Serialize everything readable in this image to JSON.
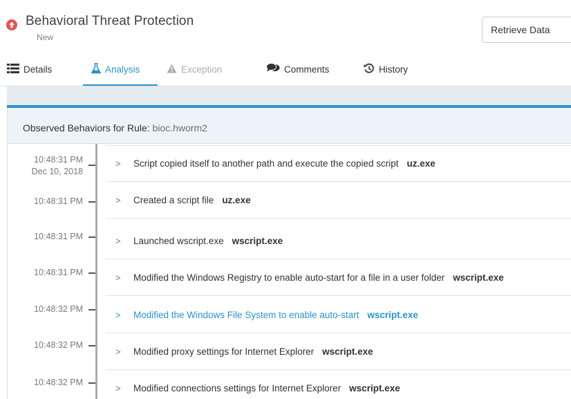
{
  "header": {
    "title": "Behavioral Threat Protection",
    "status": "New",
    "retrieve_button": "Retrieve Data",
    "alert_icon": "circle-arrow-up-icon",
    "alert_color": "#e45457"
  },
  "tabs": [
    {
      "label": "Details",
      "icon": "list-icon",
      "state": "normal"
    },
    {
      "label": "Analysis",
      "icon": "flask-icon",
      "state": "active"
    },
    {
      "label": "Exception",
      "icon": "warning-icon",
      "state": "disabled"
    },
    {
      "label": "Comments",
      "icon": "comments-icon",
      "state": "normal"
    },
    {
      "label": "History",
      "icon": "history-icon",
      "state": "normal"
    }
  ],
  "panel": {
    "heading_prefix": "Observed Behaviors for Rule:",
    "rule_name": "bioc.hworm2"
  },
  "colors": {
    "accent": "#2a93c8",
    "header_bg": "#eef3f7",
    "band_bg": "#e6ebef"
  },
  "behaviors": [
    {
      "time": "10:48:31 PM",
      "date": "Dec 10, 2018",
      "description": "Script copied itself to another path and execute the copied script",
      "process": "uz.exe"
    },
    {
      "time": "10:48:31 PM",
      "date": "",
      "description": "Created a script file",
      "process": "uz.exe"
    },
    {
      "time": "10:48:31 PM",
      "date": "",
      "description": "Launched wscript.exe",
      "process": "wscript.exe"
    },
    {
      "time": "10:48:31 PM",
      "date": "",
      "description": "Modified the Windows Registry to enable auto-start for a file in a user folder",
      "process": "wscript.exe"
    },
    {
      "time": "10:48:32 PM",
      "date": "",
      "description": "Modified the Windows File System to enable auto-start",
      "process": "wscript.exe",
      "highlighted": true
    },
    {
      "time": "10:48:32 PM",
      "date": "",
      "description": "Modified proxy settings for Internet Explorer",
      "process": "wscript.exe"
    },
    {
      "time": "10:48:32 PM",
      "date": "",
      "description": "Modified connections settings for Internet Explorer",
      "process": "wscript.exe"
    }
  ]
}
